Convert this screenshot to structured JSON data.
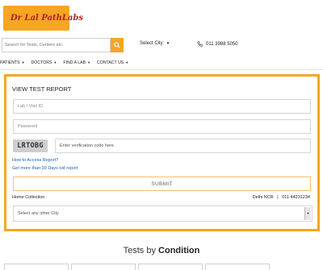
{
  "header": {
    "logo_text": "Dr Lal PathLabs"
  },
  "search": {
    "placeholder": "Search for Tests, Centers etc."
  },
  "top": {
    "select_city": "Select City",
    "phone": "011 3988 5050"
  },
  "nav": {
    "items": [
      "PATIENTS",
      "DOCTORS",
      "FIND A LAB",
      "CONTACT US"
    ]
  },
  "report": {
    "title": "VIEW TEST REPORT",
    "lab_placeholder": "Lab / Visit ID",
    "password_placeholder": "Password",
    "captcha_text": "LRTOBG",
    "verification_placeholder": "Enter verification code here",
    "how_to_access": "How to Access Report?",
    "older_report": "Get more than 30 Days old report",
    "submit_label": "SUBMIT",
    "home_collection_label": "Home Collection",
    "home_collection_city": "Delhi NCR",
    "home_collection_separator": "|",
    "home_collection_phone": "011 44231234",
    "city_select_value": "Select any other City"
  },
  "tests": {
    "title_prefix": "Tests by",
    "title_bold": "Condition"
  },
  "colors": {
    "accent": "#f5a623",
    "link": "#1a5fb4",
    "logo_red": "#b22222"
  },
  "icons": [
    "logo-mark-icon",
    "search-icon",
    "phone-icon",
    "chevron-down-icon"
  ]
}
